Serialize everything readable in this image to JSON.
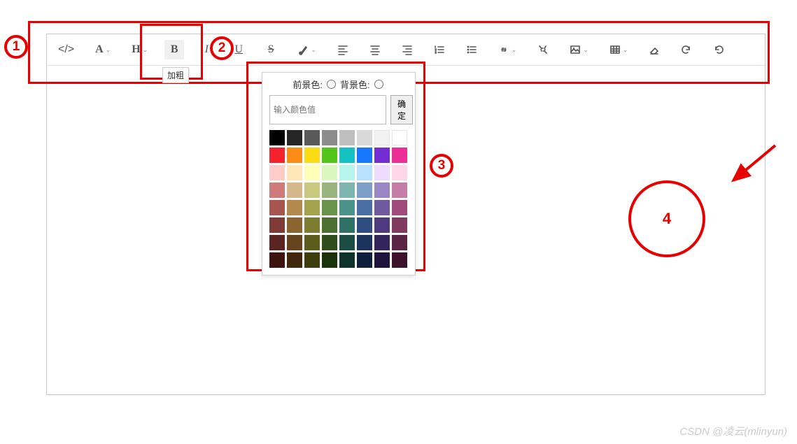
{
  "toolbar": {
    "items": [
      {
        "name": "code-view-button",
        "icon": "</>",
        "type": "text"
      },
      {
        "name": "font-family-button",
        "icon": "A",
        "caret": true,
        "type": "text",
        "bold": true,
        "serif": true
      },
      {
        "name": "heading-button",
        "icon": "H",
        "caret": true,
        "type": "text",
        "bold": true,
        "serif": true
      },
      {
        "name": "bold-button",
        "icon": "B",
        "type": "text",
        "bold": true,
        "serif": true,
        "active": true
      },
      {
        "name": "italic-button",
        "icon": "I",
        "type": "text",
        "italic": true,
        "serif": true
      },
      {
        "name": "underline-button",
        "icon": "U",
        "type": "text",
        "underline": true,
        "serif": true
      },
      {
        "name": "strike-button",
        "icon": "S",
        "type": "text",
        "strike": true,
        "serif": true
      },
      {
        "name": "color-picker-button",
        "icon": "brush",
        "caret": true,
        "type": "svg"
      },
      {
        "name": "align-left-button",
        "icon": "align-left",
        "type": "svg"
      },
      {
        "name": "align-center-button",
        "icon": "align-center",
        "type": "svg"
      },
      {
        "name": "align-right-button",
        "icon": "align-right",
        "type": "svg"
      },
      {
        "name": "ordered-list-button",
        "icon": "ol",
        "type": "svg"
      },
      {
        "name": "unordered-list-button",
        "icon": "ul",
        "type": "svg"
      },
      {
        "name": "link-button",
        "icon": "link",
        "caret": true,
        "type": "svg"
      },
      {
        "name": "unlink-button",
        "icon": "unlink",
        "type": "svg"
      },
      {
        "name": "image-button",
        "icon": "image",
        "caret": true,
        "type": "svg"
      },
      {
        "name": "table-button",
        "icon": "table",
        "caret": true,
        "type": "svg"
      },
      {
        "name": "eraser-button",
        "icon": "eraser",
        "type": "svg"
      },
      {
        "name": "redo-button",
        "icon": "redo",
        "type": "svg"
      },
      {
        "name": "undo-button",
        "icon": "undo",
        "type": "svg"
      }
    ],
    "bold_tooltip": "加粗"
  },
  "color_panel": {
    "foreground_label": "前景色:",
    "background_label": "背景色:",
    "input_placeholder": "输入颜色值",
    "confirm_label": "确定",
    "swatches": [
      "#000000",
      "#262626",
      "#595959",
      "#8c8c8c",
      "#bfbfbf",
      "#d9d9d9",
      "#f2f2f2",
      "#ffffff",
      "#f5222d",
      "#fa8c16",
      "#fadb14",
      "#52c41a",
      "#13c2c2",
      "#1677ff",
      "#722ed1",
      "#eb2f96",
      "#ffccc7",
      "#ffe7ba",
      "#ffffb8",
      "#d9f7be",
      "#b5f5ec",
      "#bae0ff",
      "#efdbff",
      "#ffd6e7",
      "#cf7b79",
      "#d4b88c",
      "#c9c97d",
      "#98b57d",
      "#7db5b0",
      "#7d9ec9",
      "#9a86c4",
      "#c47da6",
      "#a8544f",
      "#b3894d",
      "#a3a34b",
      "#6b924b",
      "#4b928b",
      "#4b6fa3",
      "#6f5aa0",
      "#a04b7c",
      "#803a36",
      "#8c6431",
      "#7d7d2f",
      "#4b702f",
      "#2f7067",
      "#2f4d80",
      "#4d3a80",
      "#803a5e",
      "#5c2420",
      "#66441d",
      "#5c5c1b",
      "#2f4d1b",
      "#1b4d44",
      "#1b335c",
      "#33245c",
      "#5c2444",
      "#3d130f",
      "#40280f",
      "#3d3d0d",
      "#1b330d",
      "#0d332b",
      "#0d1f3d",
      "#1f133d",
      "#3d132b"
    ]
  },
  "annotations": {
    "labels": [
      "1",
      "2",
      "3",
      "4"
    ]
  },
  "watermark": "CSDN @凌云(mlinyun)"
}
